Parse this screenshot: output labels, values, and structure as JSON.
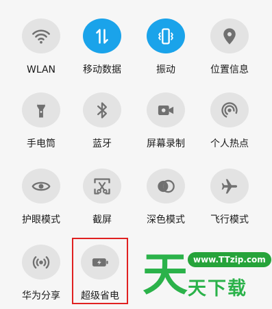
{
  "colors": {
    "active": "#1aa3ea",
    "inactive_bg": "#e3e3e3",
    "inactive_icon": "#707070",
    "highlight": "#e02020",
    "watermark": "#2bb24a"
  },
  "tiles": [
    {
      "label": "WLAN",
      "icon": "wifi-icon",
      "active": false
    },
    {
      "label": "移动数据",
      "icon": "mobile-data-icon",
      "active": true
    },
    {
      "label": "振动",
      "icon": "vibrate-icon",
      "active": true
    },
    {
      "label": "位置信息",
      "icon": "location-icon",
      "active": false
    },
    {
      "label": "手电筒",
      "icon": "flashlight-icon",
      "active": false
    },
    {
      "label": "蓝牙",
      "icon": "bluetooth-icon",
      "active": false
    },
    {
      "label": "屏幕录制",
      "icon": "screen-record-icon",
      "active": false
    },
    {
      "label": "个人热点",
      "icon": "hotspot-icon",
      "active": false
    },
    {
      "label": "护眼模式",
      "icon": "eye-icon",
      "active": false
    },
    {
      "label": "截屏",
      "icon": "screenshot-icon",
      "active": false
    },
    {
      "label": "深色模式",
      "icon": "dark-mode-icon",
      "active": false
    },
    {
      "label": "飞行模式",
      "icon": "airplane-icon",
      "active": false
    },
    {
      "label": "华为分享",
      "icon": "huawei-share-icon",
      "active": false
    },
    {
      "label": "超级省电",
      "icon": "super-power-saving-icon",
      "active": false
    }
  ],
  "watermark": {
    "url": "www.TTzip.com",
    "big": "天",
    "text": "天下载"
  }
}
